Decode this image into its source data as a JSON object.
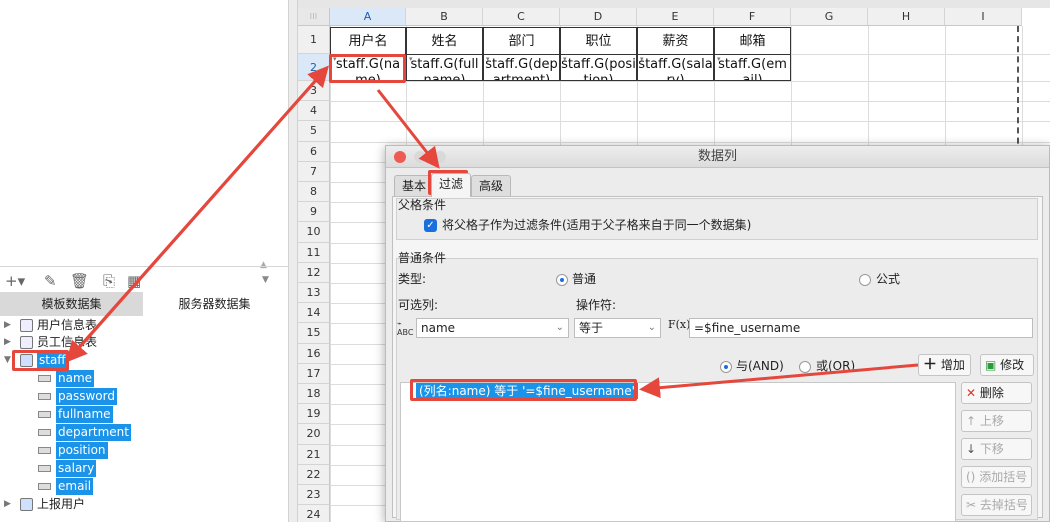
{
  "left_panel": {
    "tabs": [
      "模板数据集",
      "服务器数据集"
    ],
    "tree": [
      {
        "label": "用户信息表",
        "type": "table"
      },
      {
        "label": "员工信息表",
        "type": "table"
      },
      {
        "label": "staff",
        "type": "db",
        "selected": true
      },
      {
        "label": "上报用户",
        "type": "db"
      }
    ],
    "fields": [
      "name",
      "password",
      "fullname",
      "department",
      "position",
      "salary",
      "email"
    ]
  },
  "sheet": {
    "columns": [
      "A",
      "B",
      "C",
      "D",
      "E",
      "F",
      "G",
      "H",
      "I"
    ],
    "rows": [
      "1",
      "2",
      "3",
      "4",
      "5",
      "6",
      "7",
      "8",
      "9",
      "10",
      "11",
      "12",
      "13",
      "14",
      "15",
      "16",
      "17",
      "18",
      "19",
      "20",
      "21",
      "22",
      "23",
      "24"
    ],
    "headers": [
      "用户名",
      "姓名",
      "部门",
      "职位",
      "薪资",
      "邮箱"
    ],
    "row2": [
      "staff.G(name)",
      "staff.G(fullname)",
      "staff.G(department)",
      "staff.G(position)",
      "staff.G(salary)",
      "staff.G(email)"
    ]
  },
  "dialog": {
    "title": "数据列",
    "tabs": [
      "基本",
      "过滤",
      "高级"
    ],
    "parent_section": "父格条件",
    "parent_checkbox": "将父格子作为过滤条件(适用于父子格来自于同一个数据集)",
    "common_section": "普通条件",
    "type_label": "类型:",
    "type_normal": "普通",
    "type_formula": "公式",
    "col_label": "可选列:",
    "op_label": "操作符:",
    "col_value": "name",
    "op_value": "等于",
    "fx": "F(x)",
    "formula_value": "=$fine_username",
    "and_label": "与(AND)",
    "or_label": "或(OR)",
    "add_btn": "增加",
    "modify_btn": "修改",
    "delete_btn": "删除",
    "up_btn": "上移",
    "down_btn": "下移",
    "add_bracket_btn": "添加括号",
    "remove_bracket_btn": "去掉括号",
    "condition": "(列名:name) 等于 '=$fine_username'"
  },
  "colors": {
    "annotation": "#e5473c",
    "selection": "#1a93e8"
  }
}
